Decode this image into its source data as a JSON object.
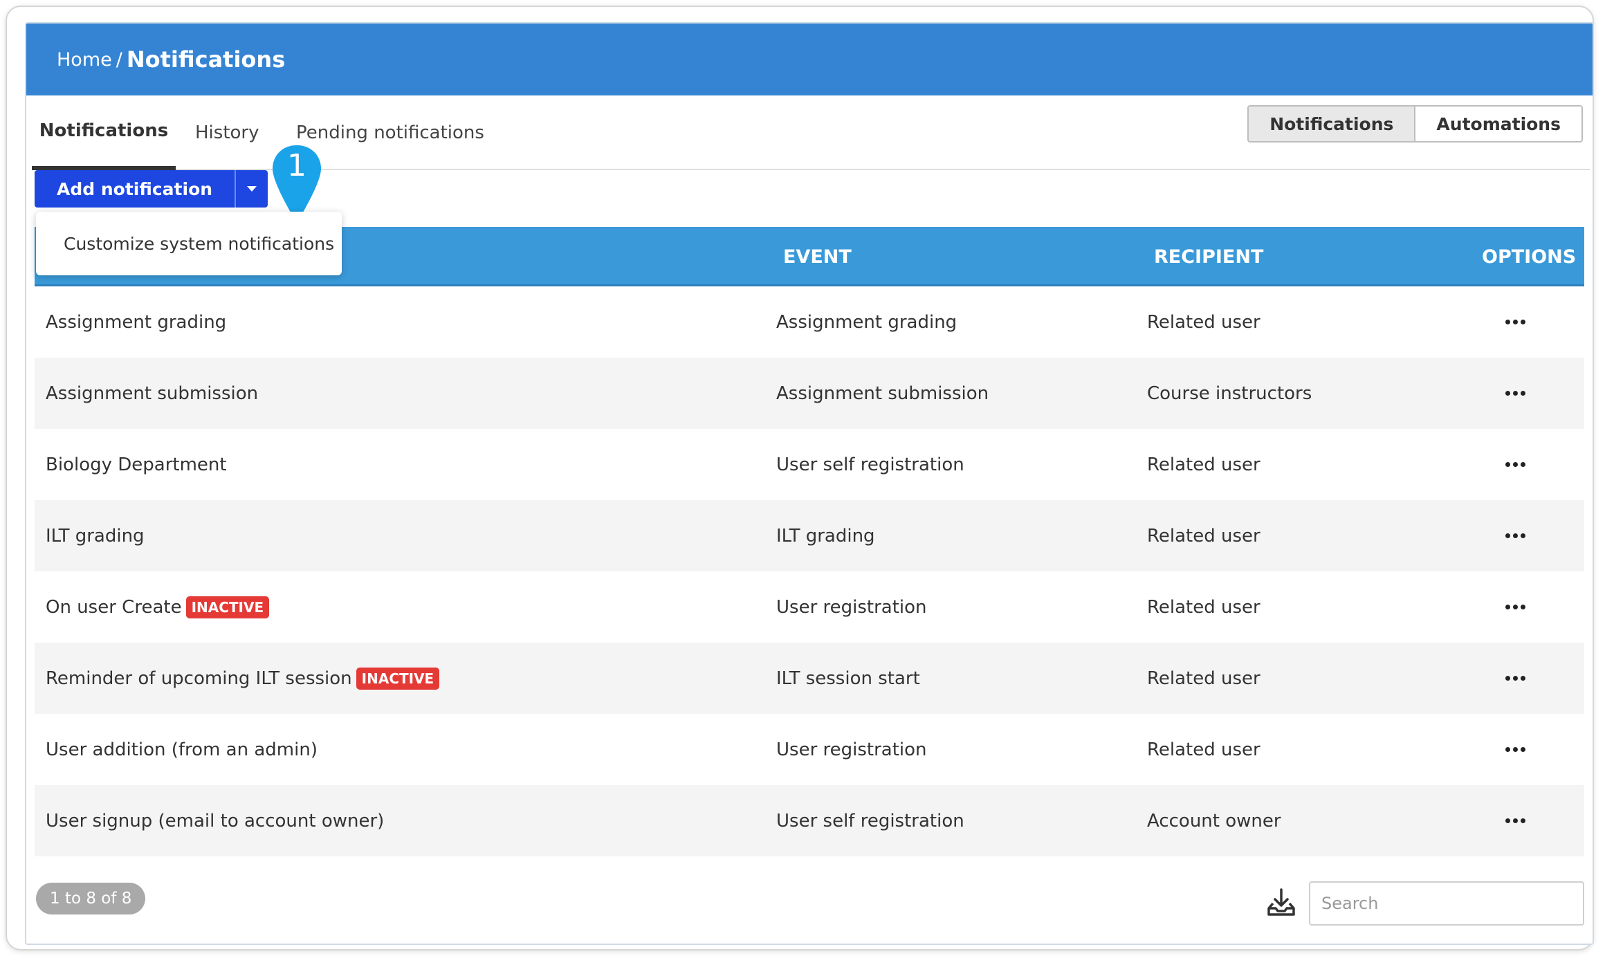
{
  "breadcrumb": {
    "home": "Home",
    "separator": "/",
    "current": "Notifications"
  },
  "tabs": [
    {
      "label": "Notifications",
      "active": true
    },
    {
      "label": "History",
      "active": false
    },
    {
      "label": "Pending notifications",
      "active": false
    }
  ],
  "view_toggle": {
    "notifications": "Notifications",
    "automations": "Automations",
    "selected": "Notifications"
  },
  "add_button": {
    "label": "Add notification"
  },
  "dropdown": {
    "items": [
      "Customize system notifications"
    ]
  },
  "callout_marker": {
    "number": "1",
    "color": "#1aa3e8"
  },
  "table": {
    "headers": {
      "name": "",
      "event": "EVENT",
      "recipient": "RECIPIENT",
      "options": "OPTIONS"
    },
    "rows": [
      {
        "name": "Assignment grading",
        "badge": "",
        "event": "Assignment grading",
        "recipient": "Related user"
      },
      {
        "name": "Assignment submission",
        "badge": "",
        "event": "Assignment submission",
        "recipient": "Course instructors"
      },
      {
        "name": "Biology Department",
        "badge": "",
        "event": "User self registration",
        "recipient": "Related user"
      },
      {
        "name": "ILT grading",
        "badge": "",
        "event": "ILT grading",
        "recipient": "Related user"
      },
      {
        "name": "On user Create",
        "badge": "INACTIVE",
        "event": "User registration",
        "recipient": "Related user"
      },
      {
        "name": "Reminder of upcoming ILT session",
        "badge": "INACTIVE",
        "event": "ILT session start",
        "recipient": "Related user"
      },
      {
        "name": "User addition (from an admin)",
        "badge": "",
        "event": "User registration",
        "recipient": "Related user"
      },
      {
        "name": "User signup (email to account owner)",
        "badge": "",
        "event": "User self registration",
        "recipient": "Account owner"
      }
    ]
  },
  "pagination": {
    "label": "1 to 8 of 8"
  },
  "search": {
    "placeholder": "Search",
    "value": ""
  },
  "colors": {
    "header": "#3584d4",
    "table_header": "#3a9ad9",
    "primary_button": "#1d47e0",
    "badge": "#e53935"
  }
}
